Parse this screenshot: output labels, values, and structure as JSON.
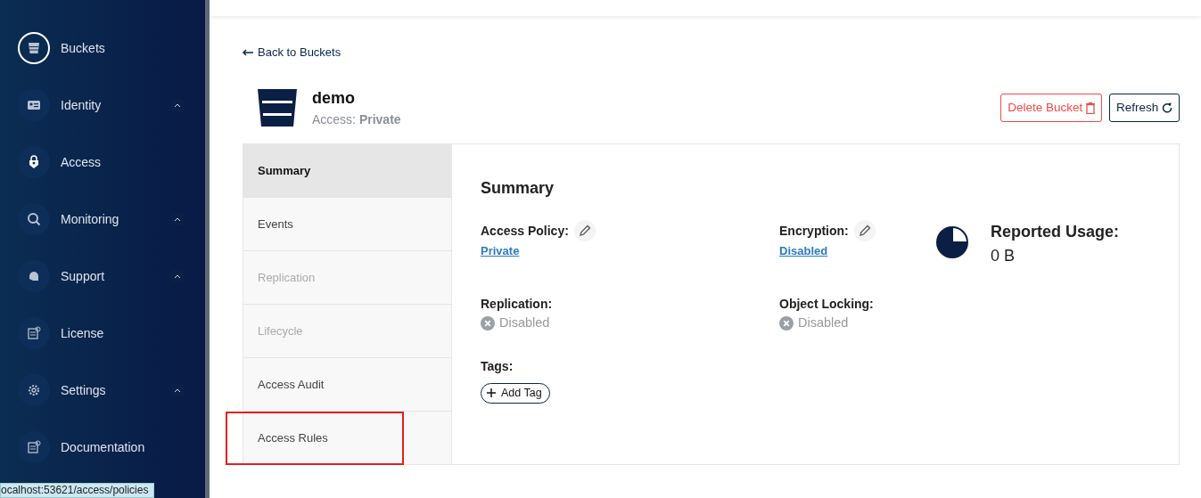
{
  "sidebar": {
    "items": [
      {
        "label": "Buckets",
        "selected": true,
        "expandable": false
      },
      {
        "label": "Identity",
        "selected": false,
        "expandable": true
      },
      {
        "label": "Access",
        "selected": false,
        "expandable": false
      },
      {
        "label": "Monitoring",
        "selected": false,
        "expandable": true
      },
      {
        "label": "Support",
        "selected": false,
        "expandable": true
      },
      {
        "label": "License",
        "selected": false,
        "expandable": false
      },
      {
        "label": "Settings",
        "selected": false,
        "expandable": true
      },
      {
        "label": "Documentation",
        "selected": false,
        "expandable": false
      }
    ]
  },
  "status_bar": {
    "url": "ocalhost:53621/access/policies"
  },
  "back_link": "Back to Buckets",
  "bucket": {
    "name": "demo",
    "access_label": "Access:",
    "access_value": "Private"
  },
  "buttons": [
    {
      "label": "Delete Bucket",
      "kind": "danger"
    },
    {
      "label": "Refresh",
      "kind": "refresh"
    }
  ],
  "tabs": [
    {
      "label": "Summary",
      "selected": true,
      "disabled": false,
      "highlighted": false
    },
    {
      "label": "Events",
      "selected": false,
      "disabled": false,
      "highlighted": false
    },
    {
      "label": "Replication",
      "selected": false,
      "disabled": true,
      "highlighted": false
    },
    {
      "label": "Lifecycle",
      "selected": false,
      "disabled": true,
      "highlighted": false
    },
    {
      "label": "Access Audit",
      "selected": false,
      "disabled": false,
      "highlighted": false
    },
    {
      "label": "Access Rules",
      "selected": false,
      "disabled": false,
      "highlighted": true
    }
  ],
  "summary": {
    "title": "Summary",
    "fields": [
      {
        "label": "Access Policy:",
        "value": "Private",
        "kind": "link",
        "editable": true
      },
      {
        "label": "Encryption:",
        "value": "Disabled",
        "kind": "link",
        "editable": true
      },
      {
        "label": "Replication:",
        "value": "Disabled",
        "kind": "status",
        "editable": false
      },
      {
        "label": "Object Locking:",
        "value": "Disabled",
        "kind": "status",
        "editable": false
      }
    ],
    "usage": {
      "label": "Reported Usage:",
      "value": "0 B"
    },
    "tags": {
      "label": "Tags:",
      "add_button": "Add Tag"
    }
  }
}
